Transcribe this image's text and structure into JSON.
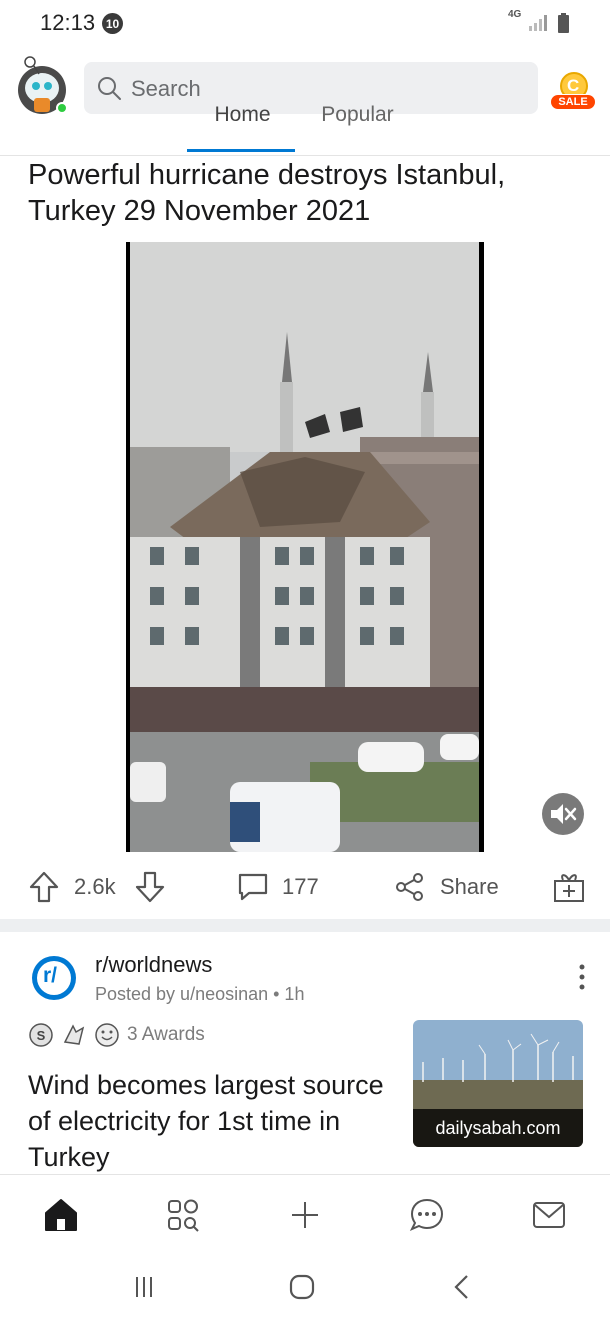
{
  "status_bar": {
    "time": "12:13",
    "notification_count": "10",
    "network": "4G"
  },
  "header": {
    "search_placeholder": "Search",
    "sale_label": "SALE",
    "coin_letter": "C",
    "tabs": [
      {
        "label": "Home",
        "active": true
      },
      {
        "label": "Popular",
        "active": false
      }
    ]
  },
  "post1": {
    "title": "Powerful hurricane destroys Istanbul, Turkey 29 November 2021",
    "votes": "2.6k",
    "comments": "177",
    "share_label": "Share"
  },
  "post2": {
    "subreddit": "r/worldnews",
    "subreddit_icon_text": "r/",
    "posted_by": "Posted by u/neosinan • 1h",
    "awards_label": "3 Awards",
    "title": "Wind becomes largest source of electricity for 1st time in Turkey",
    "link_domain": "dailysabah.com"
  },
  "bottom_nav": [
    "home-icon",
    "communities-icon",
    "create-post-icon",
    "chat-icon",
    "inbox-icon"
  ],
  "colors": {
    "accent": "#0079d3",
    "sale": "#ff4500",
    "online": "#2ecc40",
    "divider": "#edeff1"
  }
}
